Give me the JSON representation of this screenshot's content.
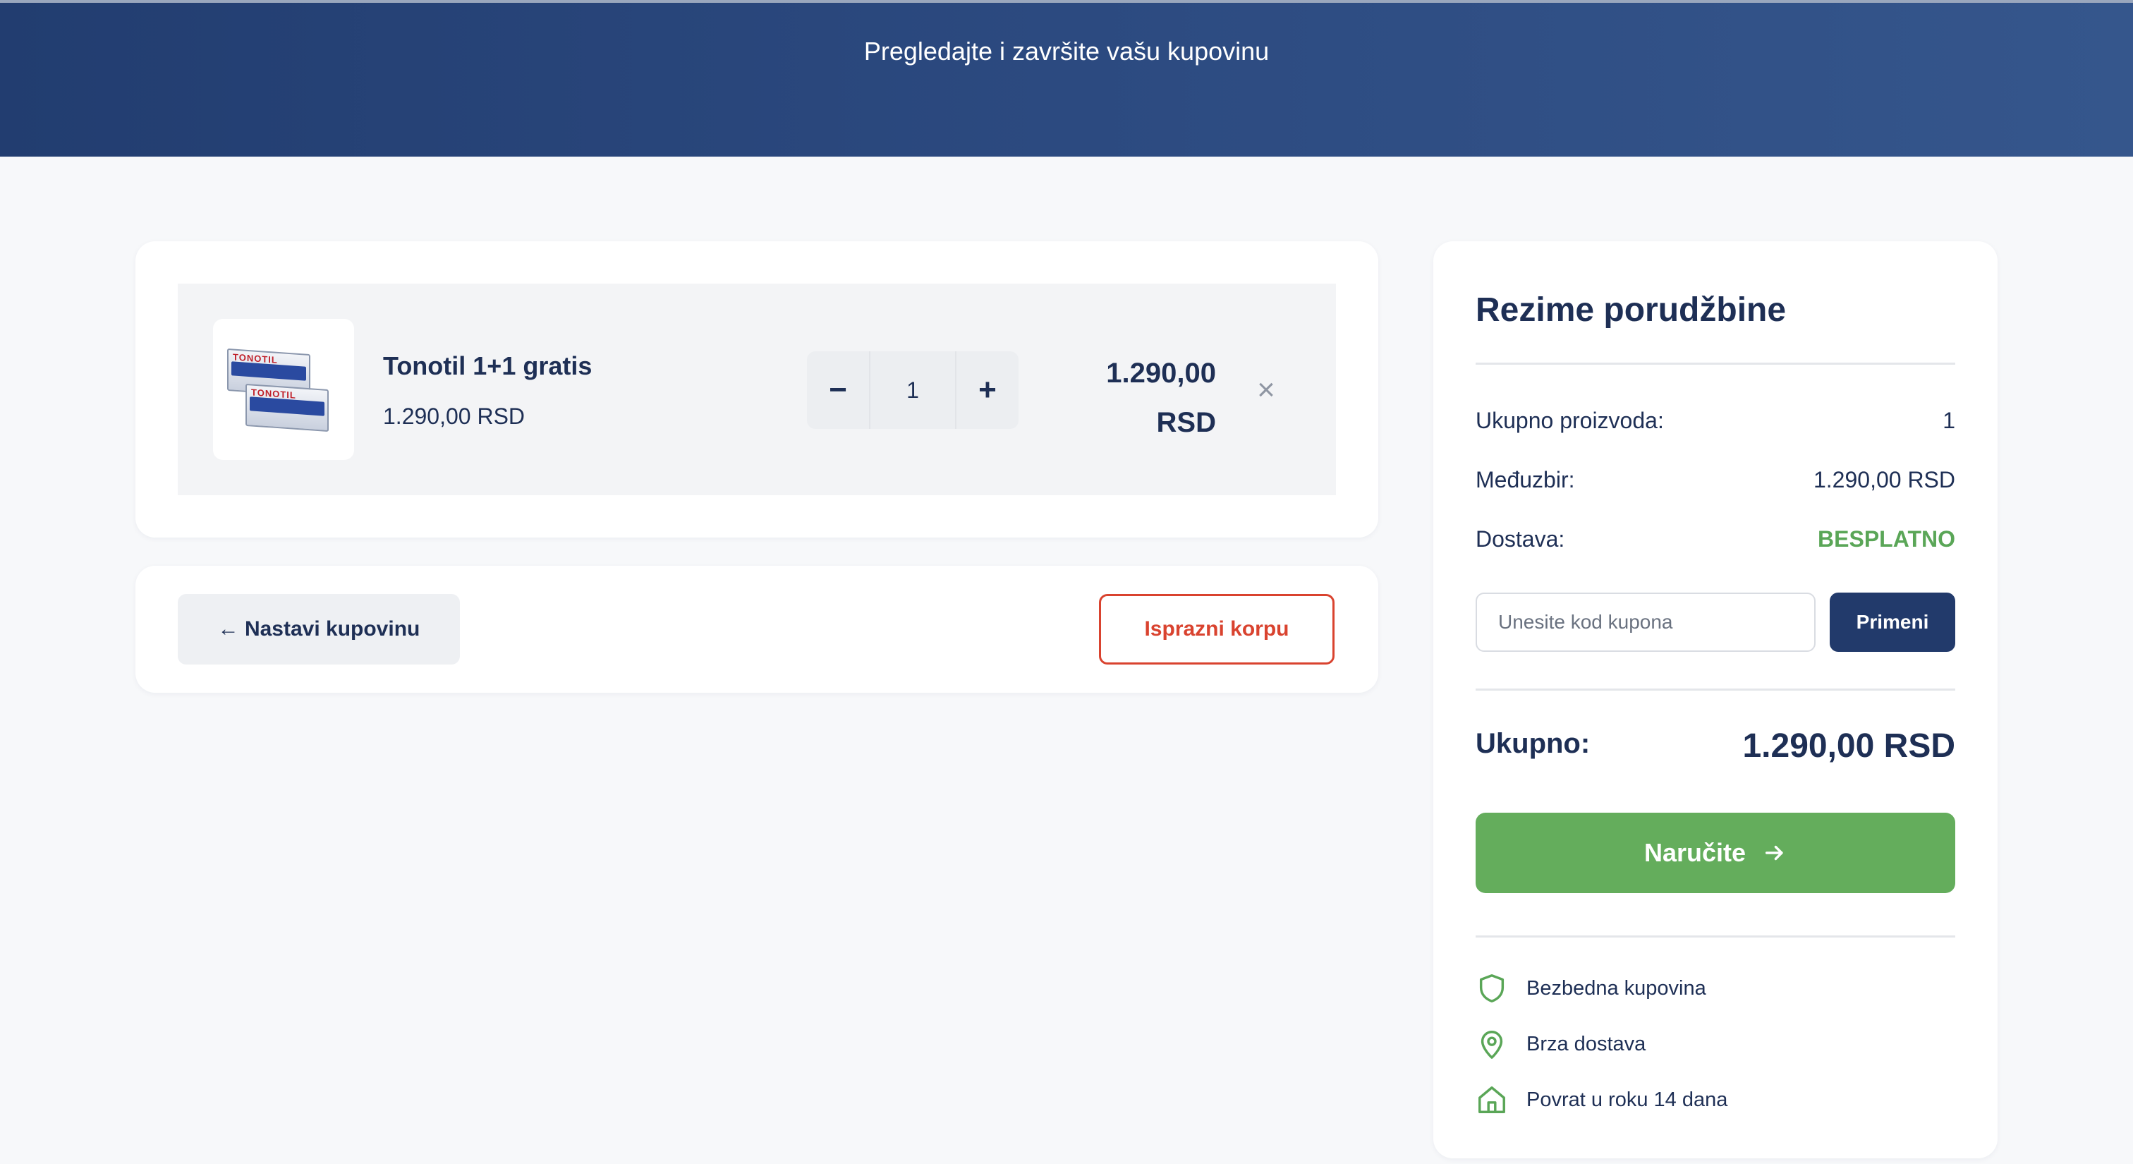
{
  "header": {
    "title": "Pregledajte i završite vašu kupovinu"
  },
  "cart": {
    "items": [
      {
        "name": "Tonotil 1+1 gratis",
        "unit_price": "1.290,00 RSD",
        "quantity": "1",
        "total_amount": "1.290,00",
        "total_currency": "RSD",
        "image_text": "TONOTIL"
      }
    ],
    "qty_minus": "−",
    "qty_plus": "+",
    "remove_icon": "×"
  },
  "actions": {
    "continue_label": "← Nastavi kupovinu",
    "empty_label": "Isprazni korpu"
  },
  "summary": {
    "title": "Rezime porudžbine",
    "products_label": "Ukupno proizvoda:",
    "products_value": "1",
    "subtotal_label": "Međuzbir:",
    "subtotal_value": "1.290,00 RSD",
    "shipping_label": "Dostava:",
    "shipping_value": "BESPLATNO",
    "coupon_placeholder": "Unesite kod kupona",
    "apply_label": "Primeni",
    "total_label": "Ukupno:",
    "total_value": "1.290,00 RSD",
    "order_label": "Naručite",
    "features": [
      {
        "icon": "shield-icon",
        "label": "Bezbedna kupovina"
      },
      {
        "icon": "map-pin-icon",
        "label": "Brza dostava"
      },
      {
        "icon": "home-icon",
        "label": "Povrat u roku 14 dana"
      }
    ]
  },
  "colors": {
    "header_bg": "#2c4a80",
    "primary": "#1e2f55",
    "danger": "#d9432f",
    "success": "#64ad5c",
    "button_dark": "#223a6b"
  }
}
